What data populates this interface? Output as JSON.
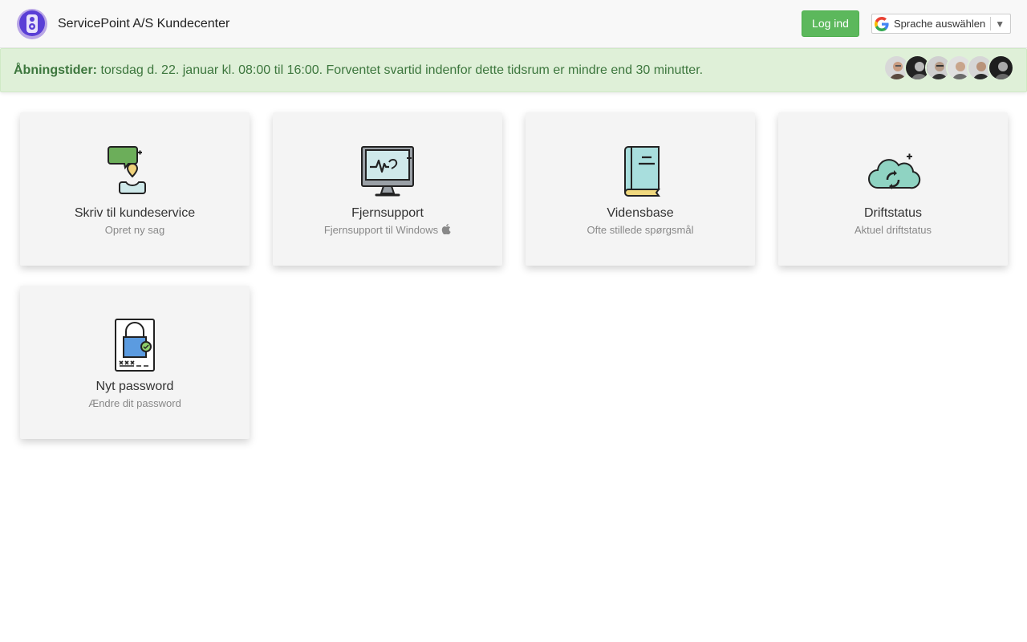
{
  "header": {
    "brand": "ServicePoint A/S Kundecenter",
    "login_label": "Log ind",
    "language_label": "Sprache auswählen",
    "language_arrow": "▼"
  },
  "banner": {
    "label": "Åbningstider:",
    "text": " torsdag d. 22. januar kl. 08:00 til 16:00. Forventet svartid indenfor dette tidsrum er mindre end 30 minutter."
  },
  "cards": [
    {
      "title": "Skriv til kundeservice",
      "subtitle": "Opret ny sag",
      "icon": "chat-person-icon"
    },
    {
      "title": "Fjernsupport",
      "subtitle": "Fjernsupport til Windows",
      "icon": "monitor-pulse-icon",
      "extra_icon": "apple-icon"
    },
    {
      "title": "Vidensbase",
      "subtitle": "Ofte stillede spørgsmål",
      "icon": "book-icon"
    },
    {
      "title": "Driftstatus",
      "subtitle": "Aktuel driftstatus",
      "icon": "cloud-sync-icon"
    },
    {
      "title": "Nyt password",
      "subtitle": "Ændre dit password",
      "icon": "lock-password-icon"
    }
  ],
  "colors": {
    "accent_green": "#5cb85c",
    "banner_bg": "#dff0d8",
    "banner_text": "#3c763d"
  }
}
